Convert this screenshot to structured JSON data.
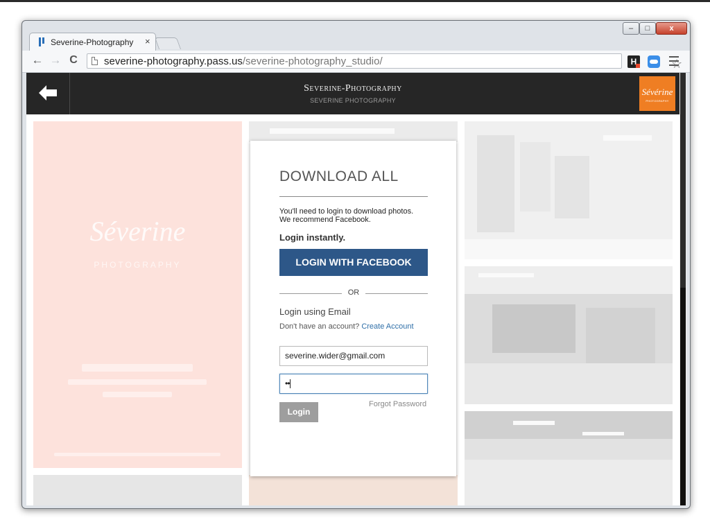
{
  "browser": {
    "tab_title": "Severine-Photography",
    "tab_close_glyph": "×",
    "url_host": "severine-photography.pass.us",
    "url_path": "/severine-photography_studio/",
    "back_glyph": "←",
    "forward_glyph": "→",
    "reload_glyph": "C",
    "star_glyph": "☆",
    "ext_h_label": "H",
    "window_min_glyph": "–",
    "window_max_glyph": "□",
    "window_close_glyph": "x"
  },
  "site": {
    "title": "Severine-Photography",
    "subtitle": "SEVERINE PHOTOGRAPHY",
    "logo_script": "Sévérine",
    "logo_sub": "PHOTOGRAPHY",
    "brand_script": "Séverine",
    "brand_sub": "PHOTOGRAPHY",
    "colors": {
      "header": "#262626",
      "logo": "#ef7e23",
      "facebook": "#2d5788",
      "link": "#2f6fa8"
    }
  },
  "login": {
    "title": "DOWNLOAD ALL",
    "note_line1": "You'll need to login to download photos.",
    "note_line2": "We recommend Facebook.",
    "instant_label": "Login instantly.",
    "facebook_button": "LOGIN WITH FACEBOOK",
    "or_label": "OR",
    "email_heading": "Login using Email",
    "no_account_text": "Don't have an account?",
    "create_account_link": "Create Account",
    "email_value": "severine.wider@gmail.com",
    "password_mask": "••",
    "forgot_password_link": "Forgot Password",
    "login_button": "Login"
  },
  "icons": {
    "back": "back-arrow-icon",
    "page": "page-icon",
    "star": "star-icon",
    "menu": "hamburger-menu-icon",
    "cloud": "cloud-icon"
  }
}
